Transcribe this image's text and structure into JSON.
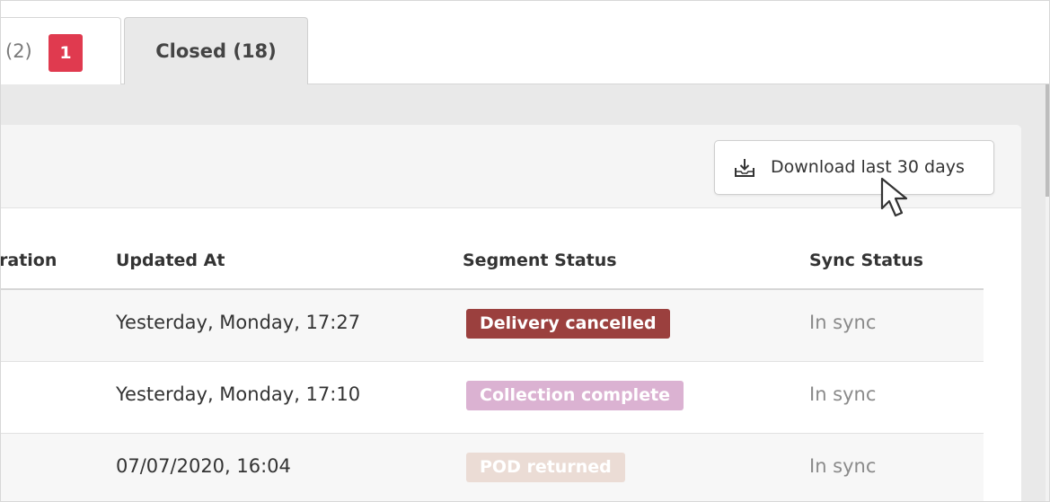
{
  "tabs": {
    "open_partial_label": "(2)",
    "open_alert_count": "1",
    "closed_label": "Closed (18)"
  },
  "toolbar": {
    "download_label": "Download last 30 days",
    "download_icon": "download-tray-icon"
  },
  "table": {
    "columns": [
      "ration",
      "Updated At",
      "Segment Status",
      "Sync Status"
    ],
    "rows": [
      {
        "updated_at": "Yesterday, Monday, 17:27",
        "segment_status": "Delivery cancelled",
        "segment_color": "#9b403e",
        "sync_status": "In sync"
      },
      {
        "updated_at": "Yesterday, Monday, 17:10",
        "segment_status": "Collection complete",
        "segment_color": "#dbb2d2",
        "sync_status": "In sync"
      },
      {
        "updated_at": "07/07/2020, 16:04",
        "segment_status": "POD returned",
        "segment_color": "#ebdcd5",
        "sync_status": "In sync"
      }
    ]
  },
  "colors": {
    "alert_badge": "#e03a4f",
    "active_tab_bg": "#e9e9e9"
  }
}
